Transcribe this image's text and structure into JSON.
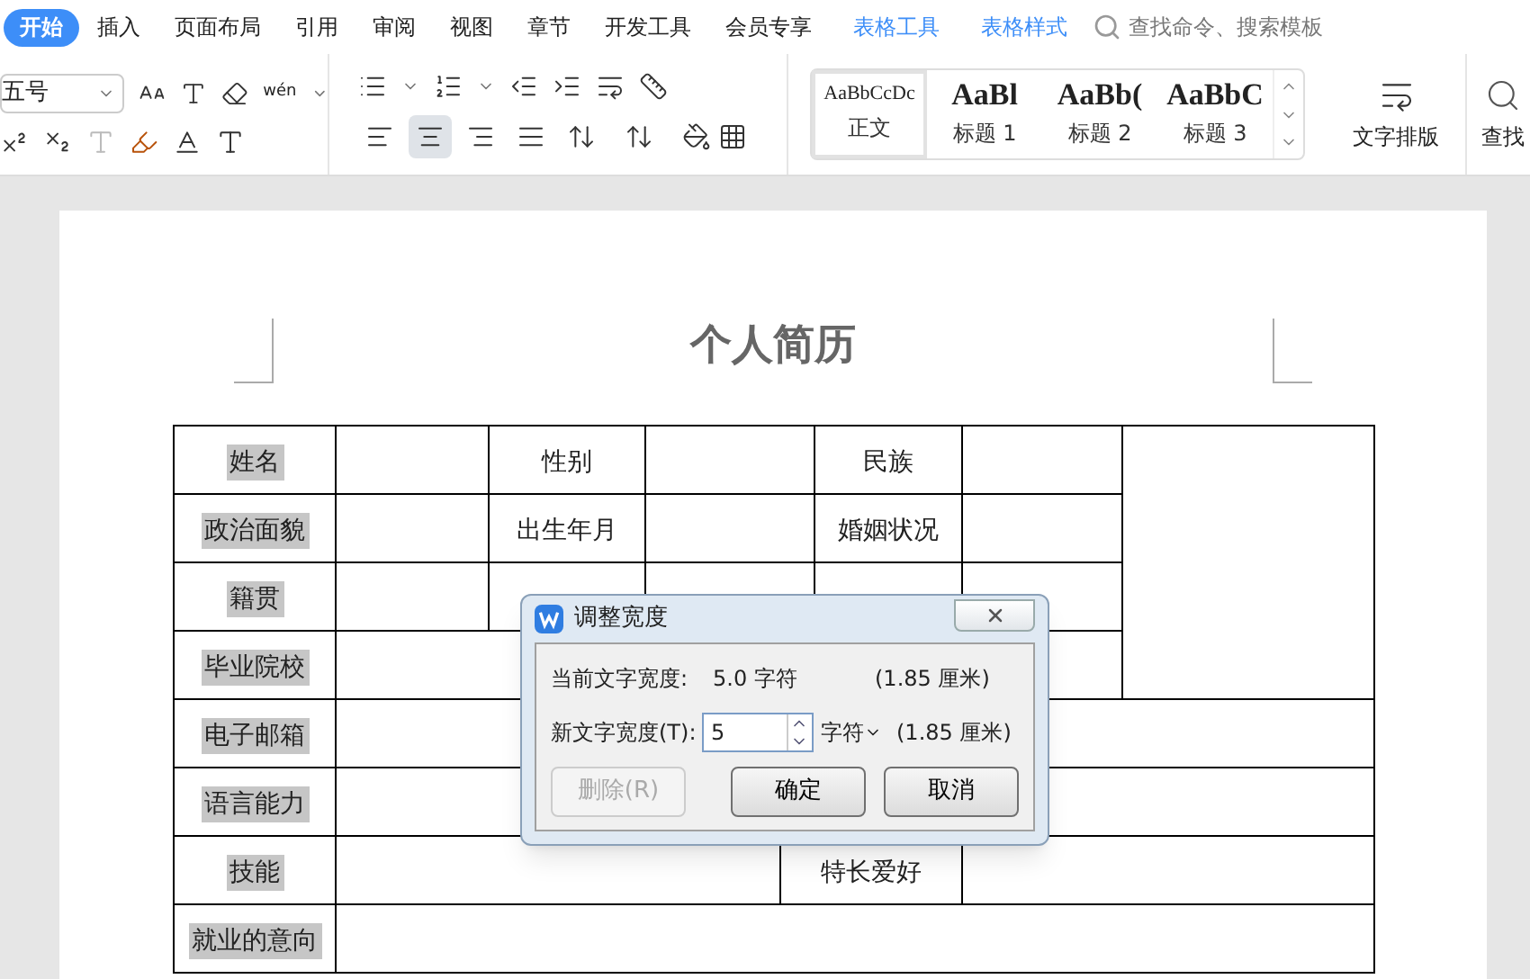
{
  "menu_tabs": [
    {
      "label": "开始",
      "selected": true,
      "kind": "main"
    },
    {
      "label": "插入",
      "selected": false,
      "kind": "main"
    },
    {
      "label": "页面布局",
      "selected": false,
      "kind": "main"
    },
    {
      "label": "引用",
      "selected": false,
      "kind": "main"
    },
    {
      "label": "审阅",
      "selected": false,
      "kind": "main"
    },
    {
      "label": "视图",
      "selected": false,
      "kind": "main"
    },
    {
      "label": "章节",
      "selected": false,
      "kind": "main"
    },
    {
      "label": "开发工具",
      "selected": false,
      "kind": "main"
    },
    {
      "label": "会员专享",
      "selected": false,
      "kind": "main"
    },
    {
      "label": "表格工具",
      "selected": false,
      "kind": "context"
    },
    {
      "label": "表格样式",
      "selected": false,
      "kind": "context"
    }
  ],
  "search": {
    "placeholder": "查找命令、搜索模板"
  },
  "ribbon": {
    "font_size": "五号",
    "pinyin_label": "wén",
    "alignment_buttons": [
      {
        "selected": false
      },
      {
        "selected": true
      },
      {
        "selected": false
      },
      {
        "selected": false
      },
      {
        "selected": false
      }
    ],
    "styles": [
      {
        "preview": "AaBbCcDc",
        "label": "正文",
        "selected": true
      },
      {
        "preview": "AaBl",
        "label": "标题 1",
        "selected": false
      },
      {
        "preview": "AaBb(",
        "label": "标题 2",
        "selected": false
      },
      {
        "preview": "AaBbC",
        "label": "标题 3",
        "selected": false
      }
    ],
    "text_layout": "文字排版",
    "find": "查找"
  },
  "document": {
    "title": "个人简历",
    "table": {
      "rows": [
        {
          "cells": [
            {
              "text": "姓名",
              "selected": true
            },
            {
              "text": "性别",
              "selected": false
            },
            {
              "text": "民族",
              "selected": false
            }
          ]
        },
        {
          "cells": [
            {
              "text": "政治面貌",
              "selected": true
            },
            {
              "text": "出生年月",
              "selected": false
            },
            {
              "text": "婚姻状况",
              "selected": false
            }
          ]
        },
        {
          "cells": [
            {
              "text": "籍贯",
              "selected": true
            }
          ]
        },
        {
          "cells": [
            {
              "text": "毕业院校",
              "selected": true
            }
          ]
        },
        {
          "cells": [
            {
              "text": "电子邮箱",
              "selected": true
            }
          ]
        },
        {
          "cells": [
            {
              "text": "语言能力",
              "selected": true
            }
          ]
        },
        {
          "cells": [
            {
              "text": "技能",
              "selected": true
            },
            {
              "text": ""
            },
            {
              "text": "特长爱好",
              "selected": false
            }
          ]
        },
        {
          "cells": [
            {
              "text": "就业的意向",
              "selected": true
            }
          ]
        }
      ]
    }
  },
  "dialog": {
    "title": "调整宽度",
    "current_label": "当前文字宽度:",
    "current_value": "5.0 字符",
    "current_cm": "(1.85 厘米)",
    "new_label": "新文字宽度(T):",
    "new_value": "5",
    "unit": "字符",
    "new_cm": "(1.85 厘米)",
    "buttons": [
      {
        "label": "删除(R)",
        "disabled": true
      },
      {
        "label": "确定",
        "disabled": false
      },
      {
        "label": "取消",
        "disabled": false
      }
    ]
  }
}
